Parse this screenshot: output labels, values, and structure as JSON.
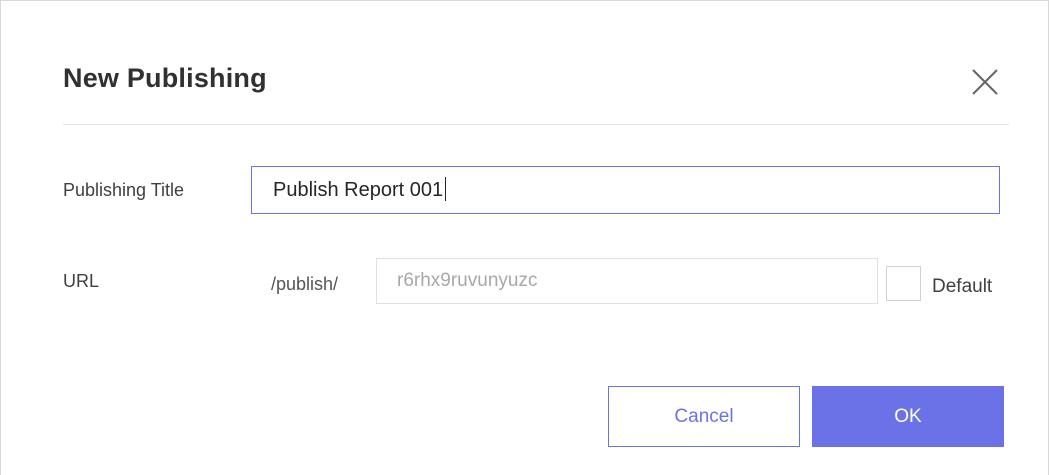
{
  "dialog": {
    "title": "New Publishing",
    "close_icon": "close-icon"
  },
  "form": {
    "publishing_title": {
      "label": "Publishing Title",
      "value": "Publish Report 001"
    },
    "url": {
      "label": "URL",
      "prefix": "/publish/",
      "placeholder": "r6rhx9ruvunyuzc",
      "value": ""
    },
    "default_checkbox": {
      "label": "Default",
      "checked": false
    }
  },
  "buttons": {
    "cancel_label": "Cancel",
    "ok_label": "OK"
  },
  "colors": {
    "accent": "#6b72e8",
    "title_text": "#303133",
    "placeholder_text": "#a8a8a8"
  }
}
